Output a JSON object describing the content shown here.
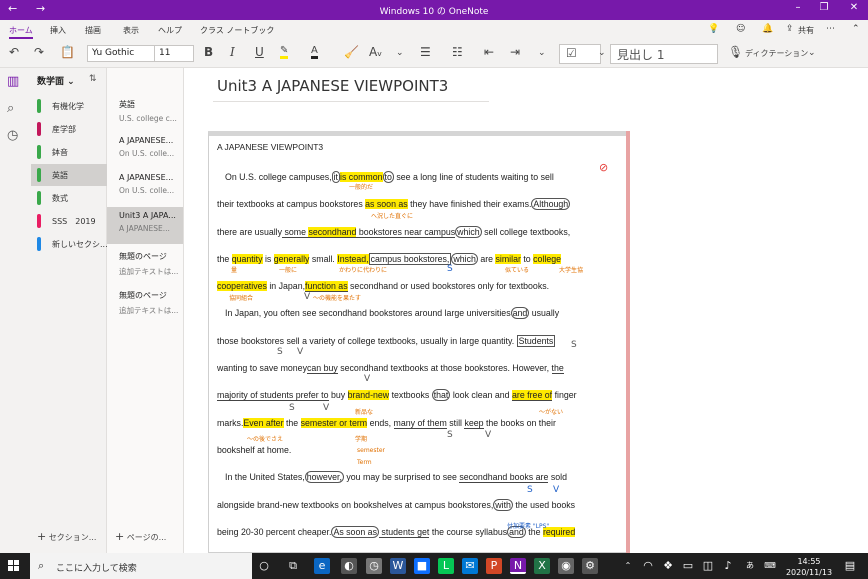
{
  "window": {
    "title": "Windows 10 の OneNote",
    "back_icon": "←",
    "forward_icon": "→"
  },
  "tabs": [
    {
      "label": "ホーム",
      "active": true
    },
    {
      "label": "挿入"
    },
    {
      "label": "描画"
    },
    {
      "label": "表示"
    },
    {
      "label": "ヘルプ"
    },
    {
      "label": "クラス ノートブック"
    }
  ],
  "share_label": "共有",
  "toolbar": {
    "font_name": "Yu Gothic",
    "font_size": "11",
    "bold": "B",
    "italic": "I",
    "underline": "U",
    "style": "見出し 1",
    "dictation": "ディクテーション"
  },
  "sidebar": {
    "notebook": "数学面",
    "sections": [
      {
        "label": "有機化学",
        "color": "#3aa84b"
      },
      {
        "label": "産学部",
        "color": "#c2185b"
      },
      {
        "label": "鉢音",
        "color": "#3aa84b"
      },
      {
        "label": "英語",
        "color": "#3aa84b",
        "active": true
      },
      {
        "label": "数式",
        "color": "#3aa84b"
      },
      {
        "label": "SSS　2019",
        "color": "#e91e63"
      },
      {
        "label": "新しいセクシ...",
        "color": "#1e88e5"
      }
    ],
    "add_section": "セクション..."
  },
  "pages": {
    "items": [
      {
        "title": "英語",
        "sub": "U.S. college c..."
      },
      {
        "title": "A JAPANESE...",
        "sub": "On U.S. colle..."
      },
      {
        "title": "A JAPANESE...",
        "sub": "On U.S. colle..."
      },
      {
        "title": "Unit3 A JAPA...",
        "sub": "A JAPANESE...",
        "active": true
      },
      {
        "title": "無題のページ",
        "sub": "追加テキストは..."
      },
      {
        "title": "無題のページ",
        "sub": "追加テキストは..."
      }
    ],
    "add_page": "ページの..."
  },
  "page": {
    "title": "Unit3 A JAPANESE VIEWPOINT3",
    "heading": "A JAPANESE VIEWPOINT3",
    "lines": {
      "l1a": "On U.S. college campuses,",
      "l1b": "it",
      "l1c": "is common",
      "l1d": "to",
      "l1e": " see a long line of students waiting to sell",
      "l2a": "their textbooks at campus bookstores ",
      "l2b": "as soon as",
      "l2c": " they have finished their exams.",
      "l2d": "Although",
      "l3a": "there are usually",
      "l3b": " some ",
      "l3c": "secondhand",
      "l3d": " bookstores near campus",
      "l3e": "which",
      "l3f": " sell college textbooks,",
      "l4a": "the ",
      "l4b": "quantity",
      "l4c": " is ",
      "l4d": "generally",
      "l4e": " small. ",
      "l4f": "Instead,",
      "l4g": "campus bookstores,",
      "l4h": "which",
      "l4i": " are ",
      "l4j": "similar",
      "l4k": " to ",
      "l4l": "college",
      "l5a": "cooperatives",
      "l5b": " in Japan,",
      "l5c": "function as",
      "l5d": " secondhand or used bookstores only for textbooks.",
      "l6a": "In Japan, you often  see secondhand bookstores around large universities",
      "l6b": "and",
      "l6c": " usually",
      "l7a": "those bookstores sell a variety of college textbooks, usually in large quantity. ",
      "l7b": "Students",
      "l8a": "wanting to save money",
      "l8b": "can buy",
      "l8c": " secondhand textbooks at those bookstores. However, ",
      "l8d": "the",
      "l9a": "majority of students",
      "l9b": " prefer to",
      "l9c": " buy ",
      "l9d": "brand-new",
      "l9e": " textbooks ",
      "l9f": "that",
      "l9g": " look clean and ",
      "l9h": "are free of",
      "l9i": " finger",
      "l10a": "marks.",
      "l10b": "Even after",
      "l10c": " the ",
      "l10d": "semester or term",
      "l10e": " ends, ",
      "l10f": "many of them",
      "l10g": " still ",
      "l10h": "keep",
      "l10i": " the books on their",
      "l11a": "bookshelf  at home.",
      "l12a": "In the United States,",
      "l12b": "however,",
      "l12c": " you may be surprised to see ",
      "l12d": "secondhand books",
      "l12e": " are",
      "l12f": " sold",
      "l13a": "alongside brand-new textbooks on bookshelves at campus bookstores,",
      "l13b": "with",
      "l13c": " the used books",
      "l14a": "being 20-30 percent cheaper.",
      "l14b": "As soon as",
      "l14c": " students",
      "l14d": " get",
      "l14e": " the course syllabus",
      "l14f": "and",
      "l14g": " the ",
      "l14h": "required"
    },
    "annotations": {
      "a1": "一般的だ",
      "a2": "へ況した直ぐに",
      "a3": "一般に",
      "a4": "量",
      "a5": "かわりに代わりに",
      "a6": "似ている",
      "a7": "大学生協",
      "a8": "協同組合",
      "a9": "〜の機能を果たす",
      "a10": "〜がない",
      "a11": "新品な",
      "a12": "〜の後でさえ",
      "a13": "学期",
      "a14": "semester",
      "a15": "Term",
      "a16": "付加要素 \"LPS\""
    }
  },
  "taskbar": {
    "search_placeholder": "ここに入力して検索",
    "time": "14:55",
    "date": "2020/11/13"
  },
  "colors": {
    "accent": "#7719aa",
    "highlight": "#ffea00",
    "ink_blue": "#1f5fc7",
    "ink_orange": "#e07000"
  }
}
